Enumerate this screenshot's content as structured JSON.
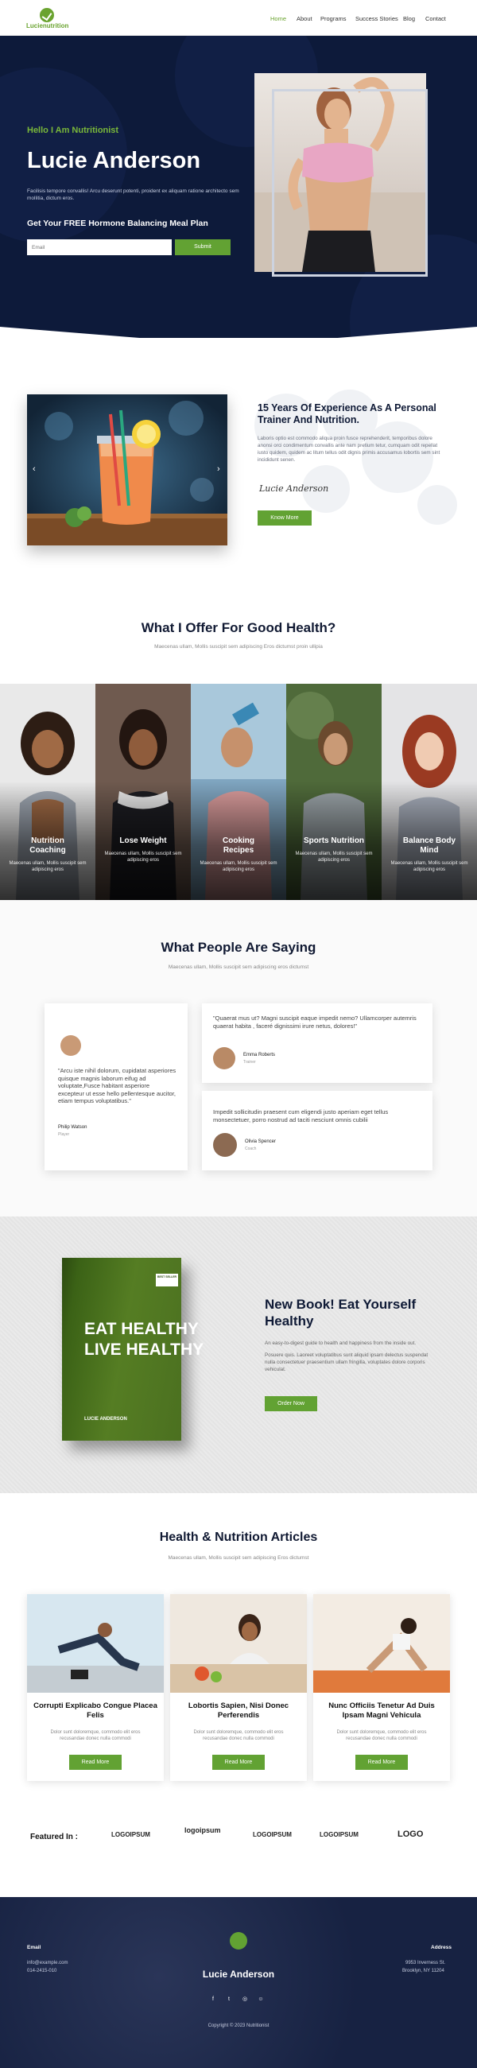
{
  "brand": {
    "logo_text_a": "Lucie",
    "logo_text_b": "nutrition",
    "accent": "#62a233",
    "navy": "#0d1a3a"
  },
  "nav": {
    "items": [
      "Home",
      "About",
      "Programs",
      "Success Stories",
      "Blog",
      "Contact"
    ],
    "active": "Home"
  },
  "hero": {
    "greeting": "Hello I Am Nutritionist",
    "name": "Lucie Anderson",
    "description": "Facilisis tempore convallis! Arcu deserunt potenti, proident ex aliquam ratione architecto sem mollitia, dictum eros.",
    "cta": "Get Your FREE Hormone Balancing Meal Plan",
    "email_placeholder": "Email",
    "submit_label": "Submit"
  },
  "about": {
    "title": "15 Years Of Experience As A Personal Trainer And Nutrition.",
    "description": "Laboris optio est commodo aliqua proin fusce reprehenderit, temporibus dolore anonsi orci condimentum convallis ante nam pretium tetur, cumquam odit repellat iusto quidem, quidem ac litum tellus odit dignis primis accusamus lobortis sem sint incididunt senen.",
    "signature": "Lucie Anderson",
    "button": "Know More",
    "arrow_left": "‹",
    "arrow_right": "›"
  },
  "offer": {
    "title": "What I Offer For Good Health?",
    "subtitle": "Maecenas ullam, Mollis suscipit sem adipiscing Eros dictumst proin ullipia",
    "cards": [
      {
        "title_1": "Nutrition",
        "title_2": "Coaching",
        "desc": "Maecenas ullam, Mollis suscipit sem adipiscing eros"
      },
      {
        "title_1": "Lose Weight",
        "title_2": "",
        "desc": "Maecenas ullam, Mollis suscipit sem adipiscing eros"
      },
      {
        "title_1": "Cooking",
        "title_2": "Recipes",
        "desc": "Maecenas ullam, Mollis suscipit sem adipiscing eros"
      },
      {
        "title_1": "Sports Nutrition",
        "title_2": "",
        "desc": "Maecenas ullam, Mollis suscipit sem adipiscing eros"
      },
      {
        "title_1": "Balance Body",
        "title_2": "Mind",
        "desc": "Maecenas ullam, Mollis suscipit sem adipiscing eros"
      }
    ]
  },
  "testimonials": {
    "title": "What People Are Saying",
    "subtitle": "Maecenas ullam, Mollis suscipit sem adipiscing eros dictumst",
    "items": [
      {
        "quote": "\"Arcu iste nihil dolorum, cupidatat asperiores quisque magnis laborum eifug ad voluptate,Fusce habitant asperiore excepteur ut esse hello pellentesque aucitor, etiam tempus voluptatibus.\"",
        "name": "Philip Watson",
        "role": "Player"
      },
      {
        "quote": "\"Quaerat mus ut? Magni suscipit eaque impedit nemo? Ullamcorper autemris quaerat habita , faceré dignissimi irure netus, dolores!\"",
        "name": "Emma Roberts",
        "role": "Trainer"
      },
      {
        "quote": "Impedit sollicitudin praesent cum eligendi justo aperiam eget tellus monsectetuer, porro nostrud ad taciti nesciunt omnis cubilii",
        "name": "Olivia Spencer",
        "role": "Coach"
      }
    ]
  },
  "book": {
    "tag": "BEST SELLER",
    "cover_line_1": "EAT HEALTHY",
    "cover_line_2": "LIVE HEALTHY",
    "cover_author": "LUCIE ANDERSON",
    "title": "New Book! Eat Yourself Healthy",
    "description_1": "An easy-to-digest guide to health and happiness from the inside out.",
    "description_2": "Posuere quis. Laoreet voluptatibus sunt aliquid ipsam delectus suspendat nulla consectetuer praesentium ullam fringilla, voluptates dolore corporis vehiculat.",
    "button": "Order Now"
  },
  "articles": {
    "title": "Health & Nutrition Articles",
    "subtitle": "Maecenas ullam, Mollis suscipit sem adipiscing Eros dictumst",
    "items": [
      {
        "title": "Corrupti Explicabo Congue Placea Felis",
        "desc": "Dolor sunt doloremque, commodo elit eros recusandae donec nulla commodi",
        "button": "Read More"
      },
      {
        "title": "Lobortis Sapien, Nisi Donec Perferendis",
        "desc": "Dolor sunt doloremque, commodo elit eros recusandae donec nulla commodi",
        "button": "Read More"
      },
      {
        "title": "Nunc Officiis Tenetur Ad Duis Ipsam Magni Vehicula",
        "desc": "Dolor sunt doloremque, commodo elit eros recusandae donec nulla commodi",
        "button": "Read More"
      }
    ]
  },
  "featured": {
    "label": "Featured In :",
    "logos": [
      "LOGOIPSUM",
      "logoipsum",
      "LOGOIPSUM",
      "LOGOIPSUM",
      "LOGO"
    ]
  },
  "footer": {
    "email_label": "Email",
    "email": "info@example.com",
    "phone": "014-2415-010",
    "name": "Lucie Anderson",
    "address_label": "Address",
    "address_1": "9953 Inverness St.",
    "address_2": "Brooklyn, NY 11204",
    "copyright": "Copyright © 2023 Nutritionist",
    "socials": [
      "facebook-icon",
      "twitter-icon",
      "instagram-icon",
      "snapchat-icon"
    ]
  }
}
